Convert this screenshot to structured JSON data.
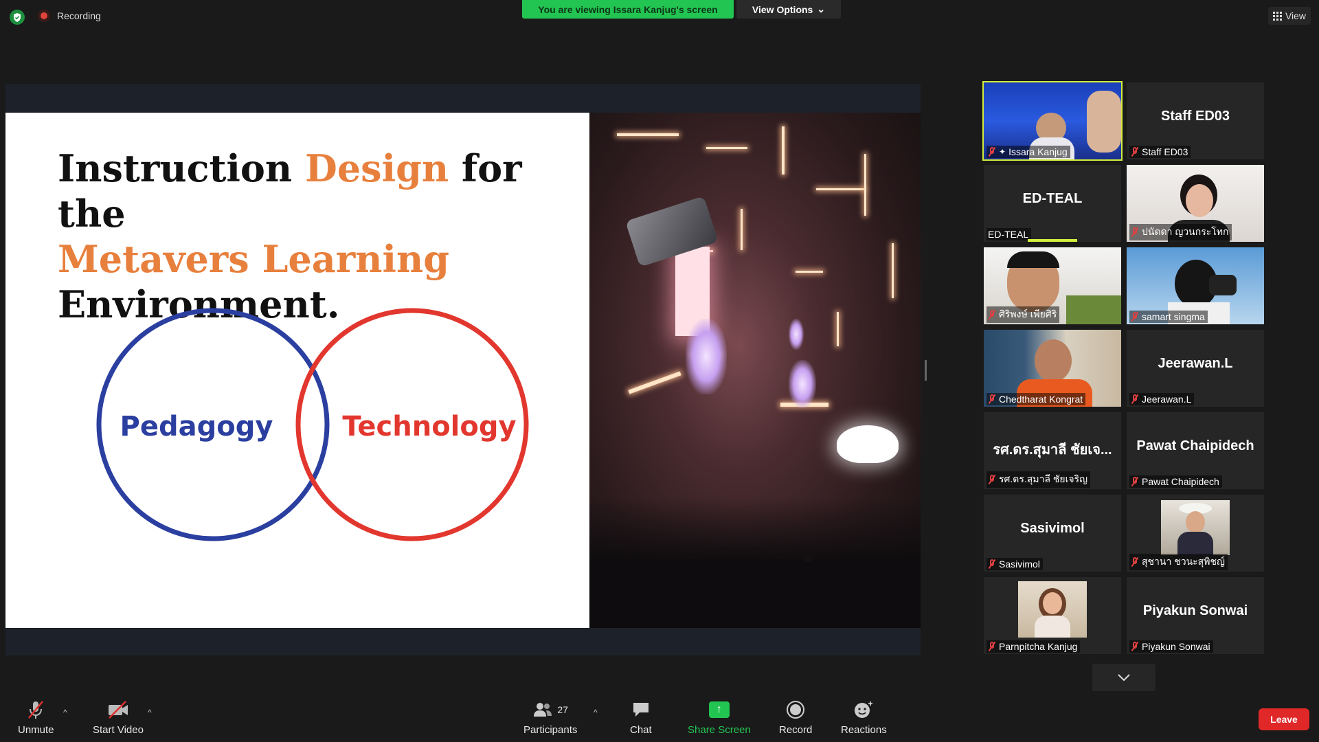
{
  "topbar": {
    "recording_label": "Recording",
    "viewing_banner": "You are viewing Issara Kanjug's screen",
    "view_options_label": "View Options",
    "view_button_label": "View"
  },
  "slide": {
    "title_parts": [
      "Instruction ",
      "Design",
      " for the ",
      "Metavers Learning",
      "Environment."
    ],
    "venn_left": "Pedagogy",
    "venn_right": "Technology",
    "colors": {
      "accent": "#e8803d",
      "left_circle": "#2b3fa0",
      "right_circle": "#e2372e"
    }
  },
  "gallery": {
    "tiles": [
      {
        "big": "",
        "label": "Issara Kanjug",
        "video": true,
        "speaking": true,
        "pinned": true
      },
      {
        "big": "Staff ED03",
        "label": "Staff ED03",
        "video": false
      },
      {
        "big": "ED-TEAL",
        "label": "ED-TEAL",
        "video": false,
        "voice": true
      },
      {
        "big": "",
        "label": "ปนัดดา ญวนกระโทก",
        "video": true
      },
      {
        "big": "",
        "label": "ศิริพงษ์ เพียศิริ",
        "video": true
      },
      {
        "big": "",
        "label": "samart singma",
        "video": true
      },
      {
        "big": "",
        "label": "Chedtharat Kongrat",
        "video": true
      },
      {
        "big": "Jeerawan.L",
        "label": "Jeerawan.L",
        "video": false
      },
      {
        "big": "รศ.ดร.สุมาลี ชัยเจ...",
        "label": "รศ.ดร.สุมาลี ชัยเจริญ",
        "video": false
      },
      {
        "big": "Pawat Chaipidech",
        "label": "Pawat Chaipidech",
        "video": false
      },
      {
        "big": "Sasivimol",
        "label": "Sasivimol",
        "video": false
      },
      {
        "big": "",
        "label": "สุชานา ชวนะสุพิชญ์",
        "video": true
      },
      {
        "big": "",
        "label": "Parnpitcha Kanjug",
        "video": true
      },
      {
        "big": "Piyakun Sonwai",
        "label": "Piyakun Sonwai",
        "video": false
      }
    ]
  },
  "toolbar": {
    "unmute": "Unmute",
    "start_video": "Start Video",
    "participants": "Participants",
    "participants_count": "27",
    "chat": "Chat",
    "share_screen": "Share Screen",
    "record": "Record",
    "reactions": "Reactions",
    "leave": "Leave"
  }
}
